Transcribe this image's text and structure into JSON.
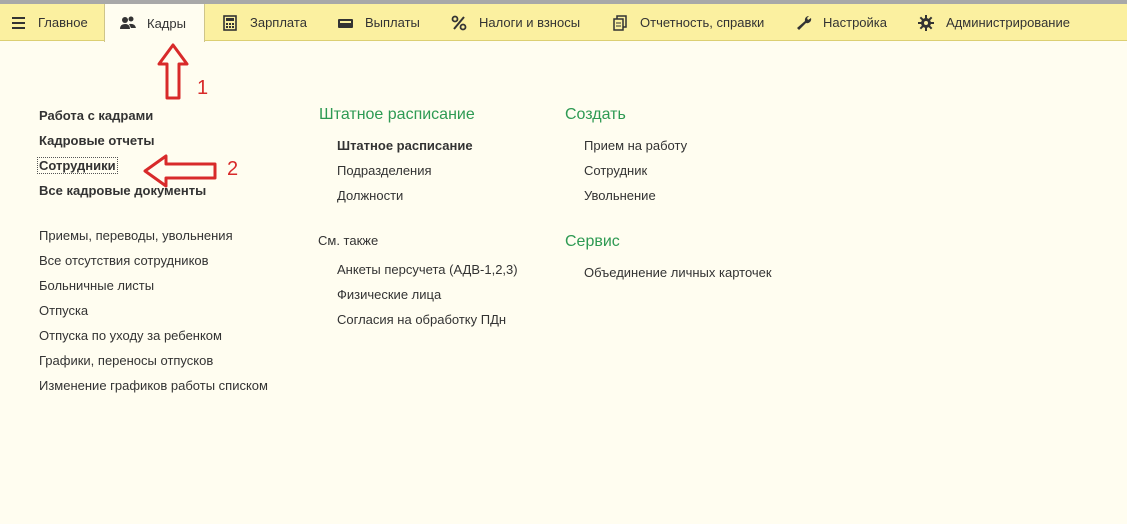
{
  "topbar": {
    "tabs": [
      {
        "label": "Главное",
        "icon": "menu-icon"
      },
      {
        "label": "Кадры",
        "icon": "people-icon"
      },
      {
        "label": "Зарплата",
        "icon": "calculator-icon"
      },
      {
        "label": "Выплаты",
        "icon": "wallet-icon"
      },
      {
        "label": "Налоги и взносы",
        "icon": "percent-icon"
      },
      {
        "label": "Отчетность, справки",
        "icon": "documents-icon"
      },
      {
        "label": "Настройка",
        "icon": "wrench-icon"
      },
      {
        "label": "Администрирование",
        "icon": "gear-icon"
      }
    ],
    "active_tab": "Кадры"
  },
  "left": {
    "main_links": [
      "Работа с кадрами",
      "Кадровые отчеты",
      "Сотрудники",
      "Все кадровые документы"
    ],
    "links": [
      "Приемы, переводы, увольнения",
      "Все отсутствия сотрудников",
      "Больничные листы",
      "Отпуска",
      "Отпуска по уходу за ребенком",
      "Графики, переносы отпусков",
      "Изменение графиков работы списком"
    ]
  },
  "middle": {
    "heading": "Штатное расписание",
    "links": [
      "Штатное расписание",
      "Подразделения",
      "Должности"
    ],
    "see_also_label": "См. также",
    "see_also_links": [
      "Анкеты персучета (АДВ-1,2,3)",
      "Физические лица",
      "Согласия на обработку ПДн"
    ]
  },
  "right": {
    "create_heading": "Создать",
    "create_links": [
      "Прием на работу",
      "Сотрудник",
      "Увольнение"
    ],
    "service_heading": "Сервис",
    "service_links": [
      "Объединение личных карточек"
    ]
  },
  "annotations": {
    "label1": "1",
    "label2": "2",
    "arrow_color": "#d82a2a"
  }
}
